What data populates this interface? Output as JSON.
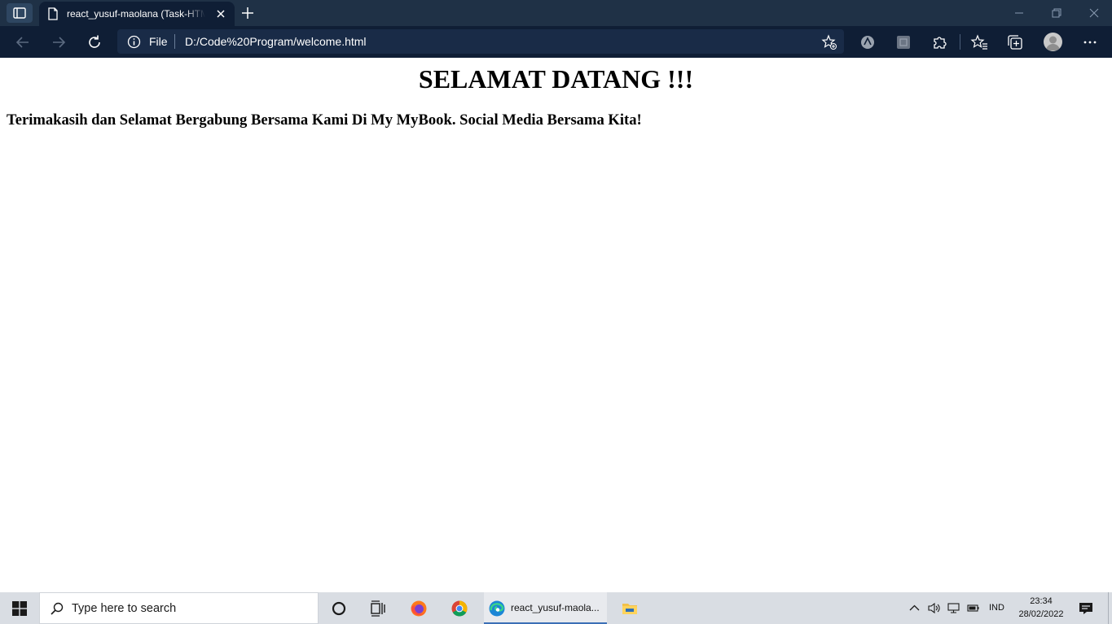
{
  "browser": {
    "tab": {
      "title": "react_yusuf-maolana (Task-HTML)",
      "icon": "document-icon"
    },
    "address_bar": {
      "scheme_label": "File",
      "url": "D:/Code%20Program/welcome.html"
    },
    "colors": {
      "titlebar": "#1f3146",
      "toolbar": "#0f1e35"
    }
  },
  "page": {
    "heading": "SELAMAT DATANG !!!",
    "message": "Terimakasih dan Selamat Bergabung Bersama Kami Di My MyBook. Social Media Bersama Kita!"
  },
  "taskbar": {
    "search_placeholder": "Type here to search",
    "pinned": [
      "cortana-icon",
      "task-view-icon",
      "firefox-icon",
      "chrome-icon",
      "edge-icon",
      "file-explorer-icon"
    ],
    "active_app_label": "react_yusuf-maola...",
    "tray": {
      "language": "IND",
      "time": "23:34",
      "date": "28/02/2022"
    }
  }
}
